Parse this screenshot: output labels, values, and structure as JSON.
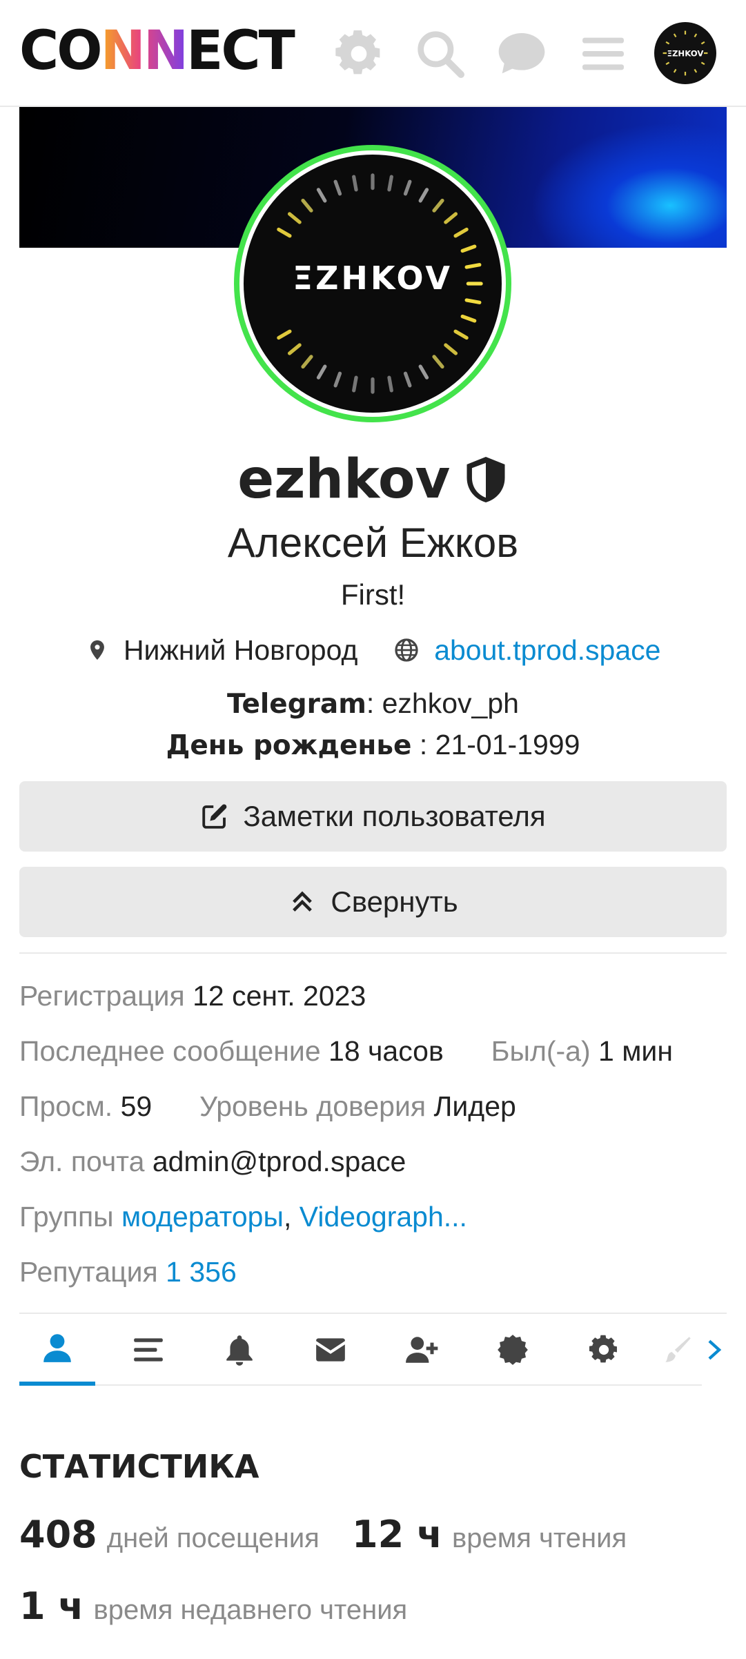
{
  "header": {
    "logo_prefix": "CO",
    "logo_nn": "NN",
    "logo_suffix": "ECT",
    "icons": [
      "gear-icon",
      "search-icon",
      "chat-icon",
      "hamburger-menu-icon"
    ]
  },
  "profile": {
    "avatar_brand": "ΞZHKOV",
    "username": "ezhkov",
    "full_name": "Алексей Ежков",
    "status": "First!",
    "location": "Нижний Новгород",
    "website": "about.tprod.space",
    "telegram_label": "Telegram",
    "telegram_value": ": ezhkov_ph",
    "birthday_label": "День рожденье",
    "birthday_value": " : 21-01-1999"
  },
  "buttons": {
    "notes": "Заметки пользователя",
    "collapse": "Свернуть"
  },
  "meta": {
    "registration_label": "Регистрация",
    "registration_value": "12 сент. 2023",
    "last_post_label": "Последнее сообщение",
    "last_post_value": "18 часов",
    "seen_label": "Был(-а)",
    "seen_value": "1 мин",
    "views_label": "Просм.",
    "views_value": "59",
    "trust_label": "Уровень доверия",
    "trust_value": "Лидер",
    "email_label": "Эл. почта",
    "email_value": "admin@tprod.space",
    "groups_label": "Группы",
    "group_1": "модераторы",
    "group_sep": ",",
    "group_2": "Videograph...",
    "reputation_label": "Репутация",
    "reputation_value": "1 356"
  },
  "tabs": [
    "summary",
    "activity",
    "notifications",
    "messages",
    "invites",
    "badges",
    "preferences",
    "more"
  ],
  "stats": {
    "title": "СТАТИСТИКА",
    "days_visited_num": "408",
    "days_visited_label": "дней посещения",
    "read_time_num": "12 ч",
    "read_time_label": "время чтения",
    "recent_read_num": "1 ч",
    "recent_read_label": "время недавнего чтения"
  },
  "colors": {
    "accent": "#0a8bd1",
    "online_ring": "#43e34b",
    "muted": "#8a8a8a",
    "button_bg": "#e9e9e9"
  }
}
